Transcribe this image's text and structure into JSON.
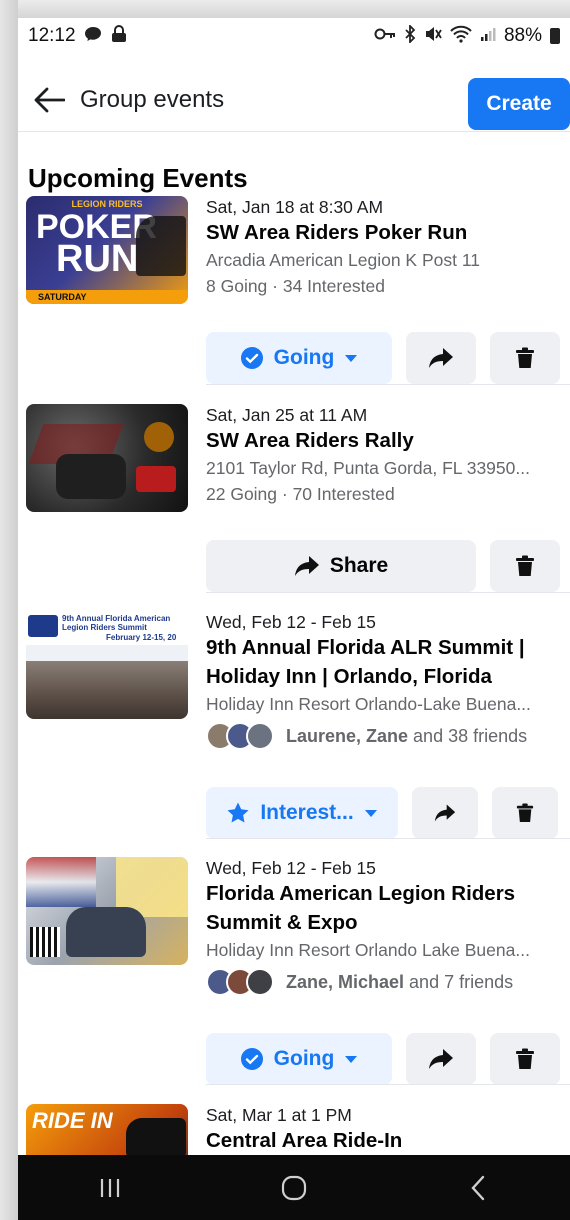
{
  "status_bar": {
    "time": "12:12",
    "battery": "88%"
  },
  "header": {
    "title": "Group events",
    "create_label": "Create"
  },
  "section_title": "Upcoming Events",
  "events": [
    {
      "date": "Sat, Jan 18 at 8:30 AM",
      "title": "SW Area Riders Poker Run",
      "location": "Arcadia American Legion K Post 11",
      "stats": "8 Going · 34 Interested",
      "primary_action": "Going",
      "thumb_text": {
        "top": "LEGION RIDERS",
        "main1": "POKER",
        "main2": "RUN",
        "bottom": "SATURDAY"
      }
    },
    {
      "date": "Sat, Jan 25 at 11 AM",
      "title": "SW Area Riders Rally",
      "location": "2101 Taylor Rd, Punta Gorda, FL 33950...",
      "stats": "22 Going · 70 Interested",
      "primary_action": "Share"
    },
    {
      "date": "Wed, Feb 12 - Feb 15",
      "title": "9th Annual Florida ALR Summit | Holiday Inn | Orlando, Florida",
      "location": "Holiday Inn Resort Orlando-Lake Buena...",
      "friends_names": "Laurene, Zane",
      "friends_rest": " and 38 friends",
      "primary_action": "Interest...",
      "thumb_text": {
        "header": "9th Annual Florida American Legion Riders Summit",
        "dates": "February 12-15, 20"
      }
    },
    {
      "date": "Wed, Feb 12 - Feb 15",
      "title": "Florida American Legion Riders Summit & Expo",
      "location": "Holiday Inn Resort Orlando Lake Buena...",
      "friends_names": "Zane, Michael",
      "friends_rest": " and 7 friends",
      "primary_action": "Going"
    },
    {
      "date": "Sat, Mar 1 at 1 PM",
      "title": "Central Area Ride-In",
      "thumb_text": {
        "main": "RIDE IN"
      }
    }
  ],
  "colors": {
    "accent": "#1877f2",
    "secondary_text": "#65676b",
    "soft_button": "#eef0f3"
  }
}
